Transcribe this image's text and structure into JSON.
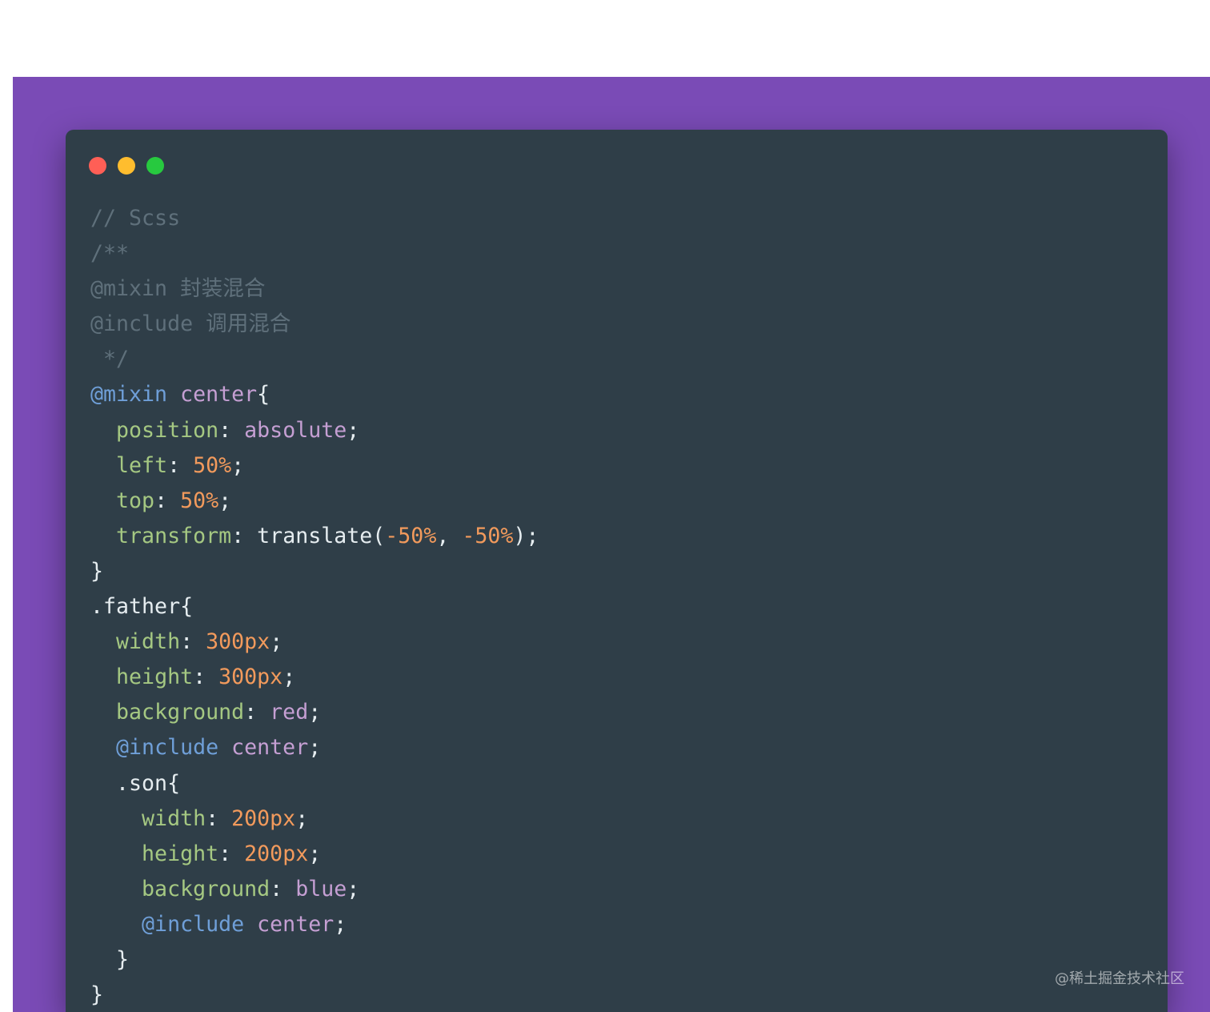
{
  "colors": {
    "page_background": "#ffffff",
    "frame_purple": "#7a4bb6",
    "editor_background": "#2f3e48",
    "dot_close": "#ff5f56",
    "dot_minimize": "#ffbd2e",
    "dot_zoom": "#27c93f",
    "comment": "#5f707b",
    "at_rule": "#6f9fd8",
    "identifier": "#c59fd3",
    "property": "#a5c882",
    "number": "#f29a5c",
    "plain": "#e6edf0"
  },
  "window_controls": [
    {
      "name": "close-dot"
    },
    {
      "name": "minimize-dot"
    },
    {
      "name": "zoom-dot"
    }
  ],
  "code_lines": [
    [
      {
        "t": "// Scss",
        "k": "comment"
      }
    ],
    [
      {
        "t": "/**",
        "k": "comment"
      }
    ],
    [
      {
        "t": "@mixin 封装混合",
        "k": "comment"
      }
    ],
    [
      {
        "t": "@include 调用混合",
        "k": "comment"
      }
    ],
    [
      {
        "t": " */",
        "k": "comment"
      }
    ],
    [
      {
        "t": "@mixin",
        "k": "at_rule"
      },
      {
        "t": " ",
        "k": "plain"
      },
      {
        "t": "center",
        "k": "identifier"
      },
      {
        "t": "{",
        "k": "plain"
      }
    ],
    [
      {
        "t": "  ",
        "k": "plain"
      },
      {
        "t": "position",
        "k": "property"
      },
      {
        "t": ": ",
        "k": "plain"
      },
      {
        "t": "absolute",
        "k": "identifier"
      },
      {
        "t": ";",
        "k": "plain"
      }
    ],
    [
      {
        "t": "  ",
        "k": "plain"
      },
      {
        "t": "left",
        "k": "property"
      },
      {
        "t": ": ",
        "k": "plain"
      },
      {
        "t": "50%",
        "k": "number"
      },
      {
        "t": ";",
        "k": "plain"
      }
    ],
    [
      {
        "t": "  ",
        "k": "plain"
      },
      {
        "t": "top",
        "k": "property"
      },
      {
        "t": ": ",
        "k": "plain"
      },
      {
        "t": "50%",
        "k": "number"
      },
      {
        "t": ";",
        "k": "plain"
      }
    ],
    [
      {
        "t": "  ",
        "k": "plain"
      },
      {
        "t": "transform",
        "k": "property"
      },
      {
        "t": ": ",
        "k": "plain"
      },
      {
        "t": "translate(",
        "k": "plain"
      },
      {
        "t": "-50%",
        "k": "number"
      },
      {
        "t": ", ",
        "k": "plain"
      },
      {
        "t": "-50%",
        "k": "number"
      },
      {
        "t": ");",
        "k": "plain"
      }
    ],
    [
      {
        "t": "}",
        "k": "plain"
      }
    ],
    [
      {
        "t": ".father{",
        "k": "plain"
      }
    ],
    [
      {
        "t": "  ",
        "k": "plain"
      },
      {
        "t": "width",
        "k": "property"
      },
      {
        "t": ": ",
        "k": "plain"
      },
      {
        "t": "300px",
        "k": "number"
      },
      {
        "t": ";",
        "k": "plain"
      }
    ],
    [
      {
        "t": "  ",
        "k": "plain"
      },
      {
        "t": "height",
        "k": "property"
      },
      {
        "t": ": ",
        "k": "plain"
      },
      {
        "t": "300px",
        "k": "number"
      },
      {
        "t": ";",
        "k": "plain"
      }
    ],
    [
      {
        "t": "  ",
        "k": "plain"
      },
      {
        "t": "background",
        "k": "property"
      },
      {
        "t": ": ",
        "k": "plain"
      },
      {
        "t": "red",
        "k": "identifier"
      },
      {
        "t": ";",
        "k": "plain"
      }
    ],
    [
      {
        "t": "  ",
        "k": "plain"
      },
      {
        "t": "@include",
        "k": "at_rule"
      },
      {
        "t": " ",
        "k": "plain"
      },
      {
        "t": "center",
        "k": "identifier"
      },
      {
        "t": ";",
        "k": "plain"
      }
    ],
    [
      {
        "t": "  .son{",
        "k": "plain"
      }
    ],
    [
      {
        "t": "    ",
        "k": "plain"
      },
      {
        "t": "width",
        "k": "property"
      },
      {
        "t": ": ",
        "k": "plain"
      },
      {
        "t": "200px",
        "k": "number"
      },
      {
        "t": ";",
        "k": "plain"
      }
    ],
    [
      {
        "t": "    ",
        "k": "plain"
      },
      {
        "t": "height",
        "k": "property"
      },
      {
        "t": ": ",
        "k": "plain"
      },
      {
        "t": "200px",
        "k": "number"
      },
      {
        "t": ";",
        "k": "plain"
      }
    ],
    [
      {
        "t": "    ",
        "k": "plain"
      },
      {
        "t": "background",
        "k": "property"
      },
      {
        "t": ": ",
        "k": "plain"
      },
      {
        "t": "blue",
        "k": "identifier"
      },
      {
        "t": ";",
        "k": "plain"
      }
    ],
    [
      {
        "t": "    ",
        "k": "plain"
      },
      {
        "t": "@include",
        "k": "at_rule"
      },
      {
        "t": " ",
        "k": "plain"
      },
      {
        "t": "center",
        "k": "identifier"
      },
      {
        "t": ";",
        "k": "plain"
      }
    ],
    [
      {
        "t": "  }",
        "k": "plain"
      }
    ],
    [
      {
        "t": "}",
        "k": "plain"
      }
    ]
  ],
  "watermark": "@稀土掘金技术社区"
}
